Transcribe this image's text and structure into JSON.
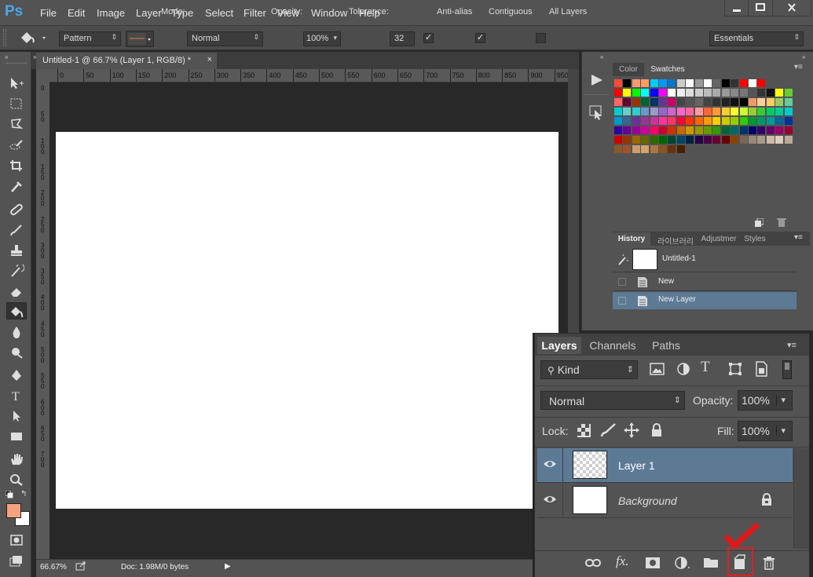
{
  "app": {
    "logo": "Ps"
  },
  "menu": [
    "File",
    "Edit",
    "Image",
    "Layer",
    "Type",
    "Select",
    "Filter",
    "View",
    "Window",
    "Help"
  ],
  "window_controls": {
    "minimize": "minimize",
    "maximize": "maximize",
    "close": "close"
  },
  "options": {
    "fill_source": "Pattern",
    "mode_label": "Mode:",
    "mode_value": "Normal",
    "opacity_label": "Opacity:",
    "opacity_value": "100%",
    "tolerance_label": "Tolerance:",
    "tolerance_value": "32",
    "anti_alias": {
      "label": "Anti-alias",
      "checked": true
    },
    "contiguous": {
      "label": "Contiguous",
      "checked": true
    },
    "all_layers": {
      "label": "All Layers",
      "checked": false
    },
    "workspace": "Essentials"
  },
  "document": {
    "tab_title": "Untitled-1 @ 66.7% (Layer 1, RGB/8) *",
    "ruler_top_labels": [
      "0",
      "50",
      "100",
      "150",
      "200",
      "250",
      "300",
      "350",
      "400",
      "450",
      "500",
      "550",
      "600",
      "650",
      "700",
      "750",
      "800",
      "850",
      "900",
      "950"
    ],
    "ruler_left_labels": [
      "0",
      "5 0",
      "1 0 0",
      "1 5 0",
      "2 0 0",
      "2 5 0",
      "3 0 0",
      "3 5 0",
      "4 0 0",
      "4 5 0",
      "5 0 0",
      "5 5 0",
      "6 0 0",
      "6 5 0",
      "7 0 0"
    ],
    "zoom": "66.67%",
    "doc_info": "Doc: 1.98M/0 bytes"
  },
  "colors": {
    "foreground": "#f4a27f",
    "background": "#ffffff",
    "accent_selection": "#5d7a95"
  },
  "swatches_panel": {
    "tabs": [
      "Color",
      "Swatches"
    ],
    "active_tab": "Swatches"
  },
  "history_panel": {
    "tabs": [
      "History",
      "라이브러리",
      "Adjustmer",
      "Styles"
    ],
    "snapshot": "Untitled-1",
    "items": [
      "New",
      "New Layer"
    ],
    "selected": "New Layer"
  },
  "layers_panel": {
    "tabs": [
      "Layers",
      "Channels",
      "Paths"
    ],
    "filter_kind": "Kind",
    "blend_mode": "Normal",
    "opacity_label": "Opacity:",
    "opacity_value": "100%",
    "lock_label": "Lock:",
    "fill_label": "Fill:",
    "fill_value": "100%",
    "layers": [
      {
        "name": "Layer 1",
        "selected": true
      },
      {
        "name": "Background",
        "selected": false,
        "locked": true
      }
    ]
  }
}
